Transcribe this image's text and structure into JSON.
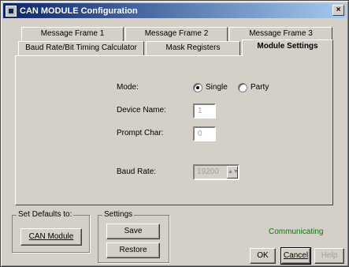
{
  "window": {
    "title": "CAN MODULE Configuration",
    "close_glyph": "×"
  },
  "tabs": {
    "row1": [
      {
        "label": "Message Frame 1"
      },
      {
        "label": "Message Frame 2"
      },
      {
        "label": "Message Frame 3"
      }
    ],
    "row2": [
      {
        "label": "Baud Rate/Bit Timing Calculator"
      },
      {
        "label": "Mask Registers"
      },
      {
        "label": "Module Settings",
        "active": true
      }
    ]
  },
  "module_settings": {
    "mode_label": "Mode:",
    "mode_options": [
      "Single",
      "Party"
    ],
    "mode_selected": "Single",
    "device_name_label": "Device Name:",
    "device_name_value": "1",
    "prompt_char_label": "Prompt Char:",
    "prompt_char_value": "0",
    "baud_rate_label": "Baud Rate:",
    "baud_rate_value": "19200"
  },
  "defaults_group": {
    "title": "Set Defaults to:",
    "button": "CAN Module"
  },
  "settings_group": {
    "title": "Settings",
    "save": "Save",
    "restore": "Restore"
  },
  "status": {
    "text": "Communicating",
    "color": "#008000"
  },
  "dialog_buttons": {
    "ok": "OK",
    "cancel": "Cancel",
    "help": "Help"
  }
}
